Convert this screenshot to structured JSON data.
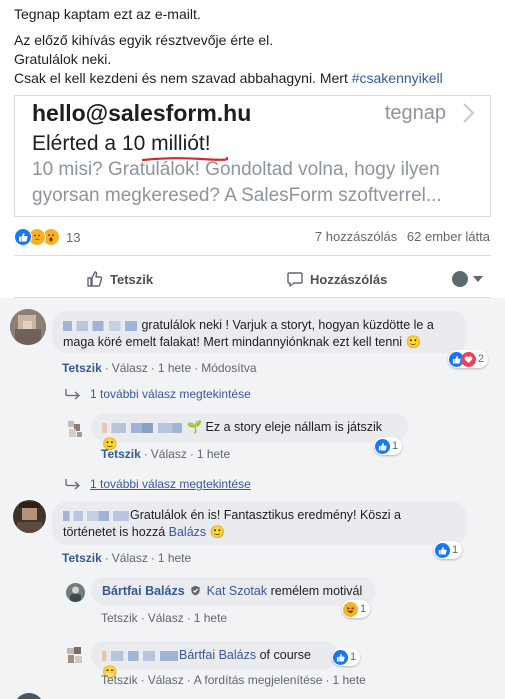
{
  "post": {
    "line1": "Tegnap kaptam ezt az e-mailt.",
    "line2": "Az előző kihívás egyik résztvevője érte el.",
    "line3": "Gratulálok neki.",
    "line4_prefix": "Csak el kell kezdeni és nem szavad abbahagyni. Mert ",
    "hashtag": "#csakennyikell"
  },
  "link_card": {
    "email": "hello@salesform.hu",
    "date": "tegnap",
    "subject_prefix": "Elérted a ",
    "subject_highlight": "10 milliót!",
    "preview": "10 misi? Gratulálok! Gondoltad volna, hogy ilyen gyorsan megkeresed? A SalesForm szoftverrel..."
  },
  "reactions": {
    "count": "13",
    "icons": [
      "like-icon",
      "care-icon",
      "wow-icon"
    ],
    "comments": "7 hozzászólás",
    "seen": "62 ember látta"
  },
  "actions": {
    "like": "Tetszik",
    "comment": "Hozzászólás"
  },
  "comments": {
    "c1": {
      "text": "gratulálok neki ! Varjuk a storyt, hogyan küzdötte le a maga köré emelt falakat! Mert mindannyiónknak ezt kell tenni 🙂",
      "like": "Tetszik",
      "reply": "Válasz",
      "time": "1 hete",
      "edited": "Módosítva",
      "reaction_count": "2"
    },
    "c1_more": "1 további válasz megtekintése",
    "r1": {
      "text": "🌱 Ez a story eleje nállam is játszik 🙂",
      "like": "Tetszik",
      "reply": "Válasz",
      "time": "1 hete",
      "reaction_count": "1"
    },
    "c1_more2": "1 további válasz megtekintése",
    "c2": {
      "text_prefix": "Gratulálok én is! Fantasztikus eredmény! Köszi a történetet is hozzá ",
      "tag": "Balázs",
      "emoji": " 🙂",
      "like": "Tetszik",
      "reply": "Válasz",
      "time": "1 hete",
      "reaction_count": "1"
    },
    "r2": {
      "author": "Bártfai Balázs",
      "tag": "Kat Szotak",
      "text": " remélem motivál",
      "like": "Tetszik",
      "reply": "Válasz",
      "time": "1 hete",
      "reaction_count": "1"
    },
    "r3": {
      "tag": "Bártfai Balázs",
      "text": " of course 😁",
      "like": "Tetszik",
      "reply": "Válasz",
      "time": "1 hete",
      "translate": "A fordítás megjelenítése",
      "reaction_count": "1"
    }
  },
  "colors": {
    "link": "#385898",
    "like_blue": "#1877f2",
    "bubble": "#e9ebee",
    "comments_bg": "#f2f3f5",
    "underline_red": "#d8262e"
  }
}
